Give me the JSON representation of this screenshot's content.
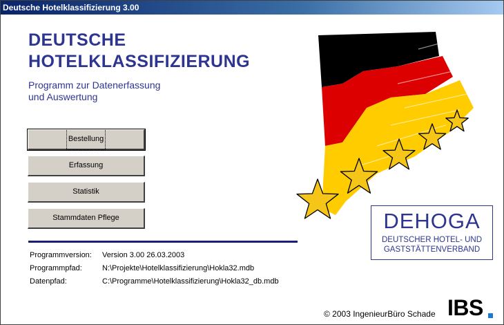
{
  "window": {
    "title": "Deutsche Hotelklassifizierung 3.00"
  },
  "header": {
    "title_line1": "DEUTSCHE",
    "title_line2": "HOTELKLASSIFIZIERUNG",
    "subtitle_line1": "Programm zur Datenerfassung",
    "subtitle_line2": "und Auswertung"
  },
  "buttons": {
    "bestellung": "Bestellung",
    "erfassung": "Erfassung",
    "statistik": "Statistik",
    "stammdaten": "Stammdaten Pflege"
  },
  "info": {
    "version_label": "Programmversion:",
    "version_value": "Version 3.00 26.03.2003",
    "programpath_label": "Programmpfad:",
    "programpath_value": "N:\\Projekte\\Hotelklassifizierung\\Hokla32.mdb",
    "datapath_label": "Datenpfad:",
    "datapath_value": "C:\\Programme\\Hotelklassifizierung\\Hokla32_db.mdb"
  },
  "dehoga": {
    "logo": "DEHOGA",
    "line1": "DEUTSCHER HOTEL- UND",
    "line2": "GASTSTÄTTENVERBAND"
  },
  "footer": {
    "copyright": "© 2003 IngenieurBüro Schade",
    "brand": "IBS"
  },
  "colors": {
    "title_blue": "#2d3590",
    "flag_black": "#000000",
    "flag_red": "#dd0000",
    "flag_gold": "#ffcc00",
    "star_fill": "#f5c518"
  }
}
